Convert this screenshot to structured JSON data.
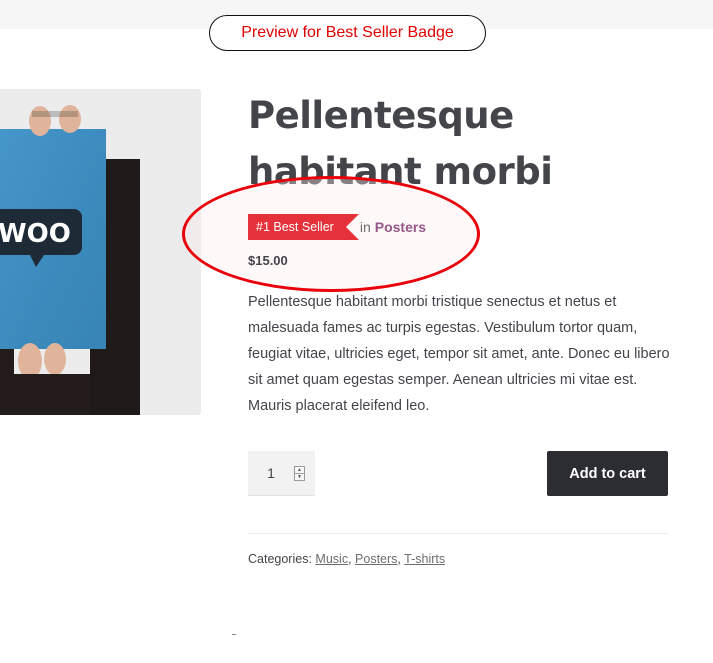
{
  "banner": {
    "preview_label": "Preview for Best Seller Badge"
  },
  "product": {
    "image_text": "WOO",
    "title": "Pellentesque habitant morbi",
    "badge": "#1 Best Seller",
    "in_label": "in",
    "category": "Posters",
    "price": "$15.00",
    "description": "Pellentesque habitant morbi tristique senectus et netus et malesuada fames ac turpis egestas. Vestibulum tortor quam, feugiat vitae, ultricies eget, tempor sit amet, ante. Donec eu libero sit amet quam egestas semper. Aenean ultricies mi vitae est. Mauris placerat eleifend leo.",
    "quantity": "1",
    "add_to_cart": "Add to cart",
    "categories": {
      "label": "Categories:",
      "items": [
        "Music",
        "Posters",
        "T-shirts"
      ]
    }
  },
  "colors": {
    "badge": "#e4313a",
    "highlight": "#e8000a",
    "link": "#96588a",
    "button": "#2c2d33"
  }
}
